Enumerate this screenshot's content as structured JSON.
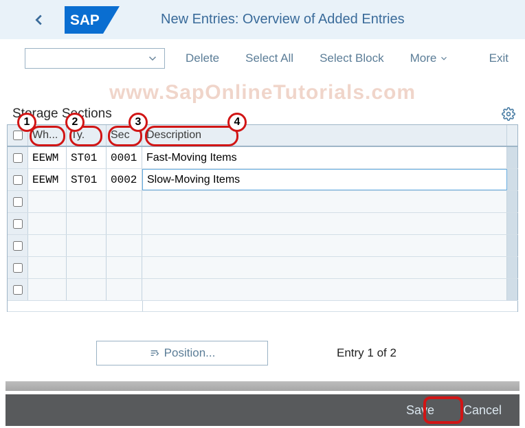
{
  "header": {
    "title": "New Entries: Overview of Added Entries"
  },
  "watermark": "www.SapOnlineTutorials.com",
  "toolbar": {
    "delete": "Delete",
    "select_all": "Select All",
    "select_block": "Select Block",
    "more": "More",
    "exit": "Exit"
  },
  "section": {
    "title": "Storage Sections"
  },
  "table": {
    "columns": {
      "wh": "Wh...",
      "ty": "Ty.",
      "sec": "Sec",
      "desc": "Description"
    },
    "rows": [
      {
        "wh": "EEWM",
        "ty": "ST01",
        "sec": "0001",
        "desc": "Fast-Moving Items"
      },
      {
        "wh": "EEWM",
        "ty": "ST01",
        "sec": "0002",
        "desc": "Slow-Moving Items"
      }
    ]
  },
  "annotations": [
    "1",
    "2",
    "3",
    "4"
  ],
  "bottom": {
    "position": "Position...",
    "entry": "Entry 1 of 2"
  },
  "footer": {
    "save": "Save",
    "cancel": "Cancel"
  }
}
